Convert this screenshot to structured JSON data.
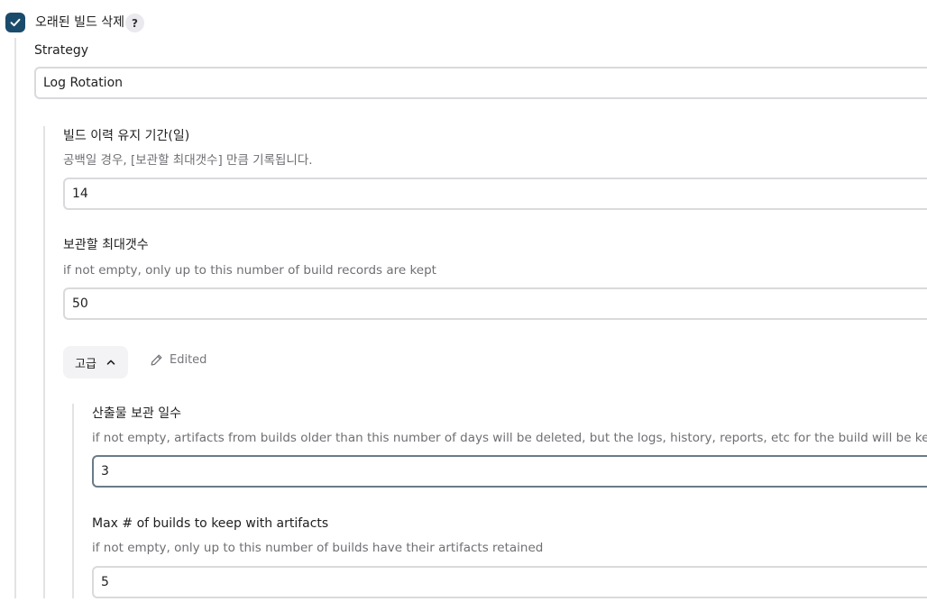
{
  "header": {
    "checkbox_label": "오래된 빌드 삭제",
    "help_label": "?",
    "checked": true
  },
  "strategy": {
    "label": "Strategy",
    "value": "Log Rotation"
  },
  "days_to_keep": {
    "label": "빌드 이력 유지 기간(일)",
    "description": "공백일 경우, [보관할 최대갯수] 만큼 기록됩니다.",
    "value": "14"
  },
  "num_to_keep": {
    "label": "보관할 최대갯수",
    "description": "if not empty, only up to this number of build records are kept",
    "value": "50"
  },
  "advanced": {
    "button_label": "고급",
    "edited_label": "Edited"
  },
  "artifact_days": {
    "label": "산출물 보관 일수",
    "description": "if not empty, artifacts from builds older than this number of days will be deleted, but the logs, history, reports, etc for the build will be kept",
    "value": "3"
  },
  "artifact_num": {
    "label": "Max # of builds to keep with artifacts",
    "description": "if not empty, only up to this number of builds have their artifacts retained",
    "value": "5"
  },
  "icons": {
    "checkbox": "check-icon",
    "advanced_toggle": "chevron-up-icon",
    "edited": "pencil-icon"
  },
  "colors": {
    "checkbox_bg": "#1b4b6b",
    "border": "#dadadd",
    "focused_border": "#6a7b87",
    "muted_text": "#6f6f74"
  }
}
